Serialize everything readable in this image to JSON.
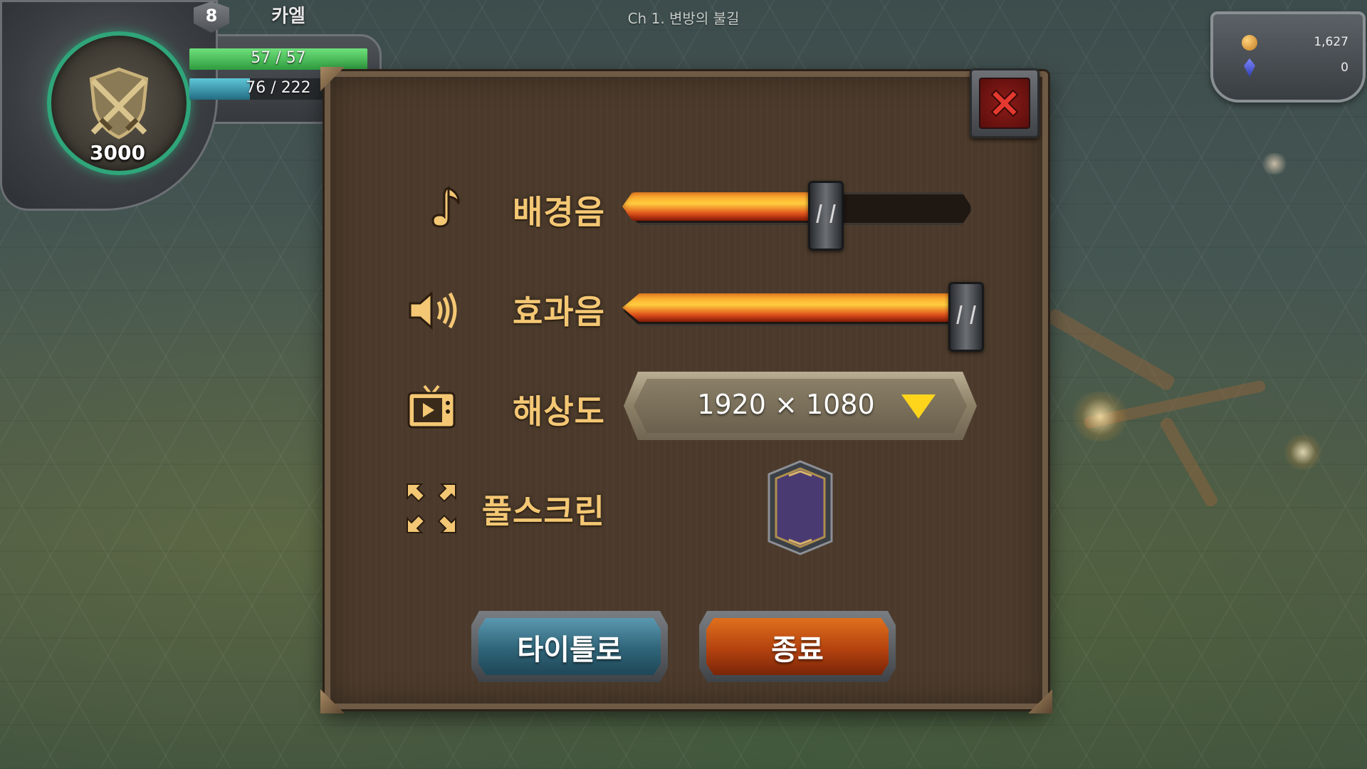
{
  "hud": {
    "chapter_title": "Ch 1. 변방의 불길",
    "player": {
      "level": "8",
      "name": "카엘",
      "power": "3000",
      "hp_text": "57 / 57",
      "hp_fraction": 1.0,
      "mp_text": "76 / 222",
      "mp_fraction": 0.34
    },
    "currency": {
      "gold": "1,627",
      "gems": "0"
    }
  },
  "settings": {
    "bgm_label": "배경음",
    "bgm_level": 0.58,
    "sfx_label": "효과음",
    "sfx_level": 1.0,
    "resolution_label": "해상도",
    "resolution_value": "1920 × 1080",
    "fullscreen_label": "풀스크린",
    "fullscreen_checked": false,
    "title_button_label": "타이틀로",
    "quit_button_label": "종료"
  },
  "colors": {
    "label_gold": "#f4c774",
    "hp_green": "#2f9c3f",
    "mp_cyan": "#236c82",
    "caret_yellow": "#ffd51c",
    "close_red": "#8c1c18"
  }
}
